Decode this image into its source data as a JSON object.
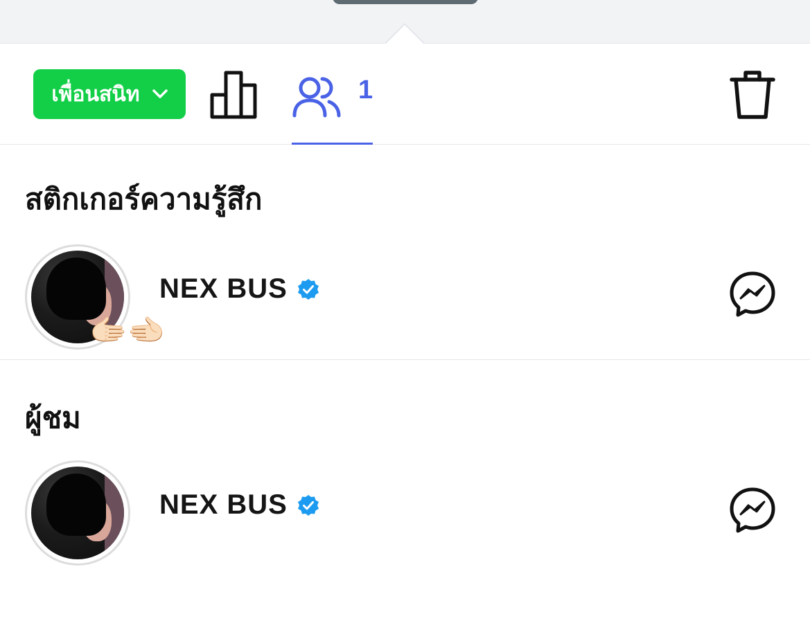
{
  "toolbar": {
    "audience_label": "เพื่อนสนิท",
    "viewers_count": "1",
    "accent_color": "#4a62e6",
    "audience_color": "#12cf47"
  },
  "sections": [
    {
      "title": "สติกเกอร์ความรู้สึก",
      "items": [
        {
          "name": "NEX BUS",
          "verified": true,
          "reaction_emoji": "🫱🏻‍🫲🏻"
        }
      ]
    },
    {
      "title": "ผู้ชม",
      "items": [
        {
          "name": "NEX BUS",
          "verified": true
        }
      ]
    }
  ],
  "icons": {
    "audience_dropdown": "chevron-down-icon",
    "stats": "bar-chart-icon",
    "viewers": "people-icon",
    "delete": "trash-icon",
    "verified": "verified-badge-icon",
    "message": "messenger-icon"
  }
}
